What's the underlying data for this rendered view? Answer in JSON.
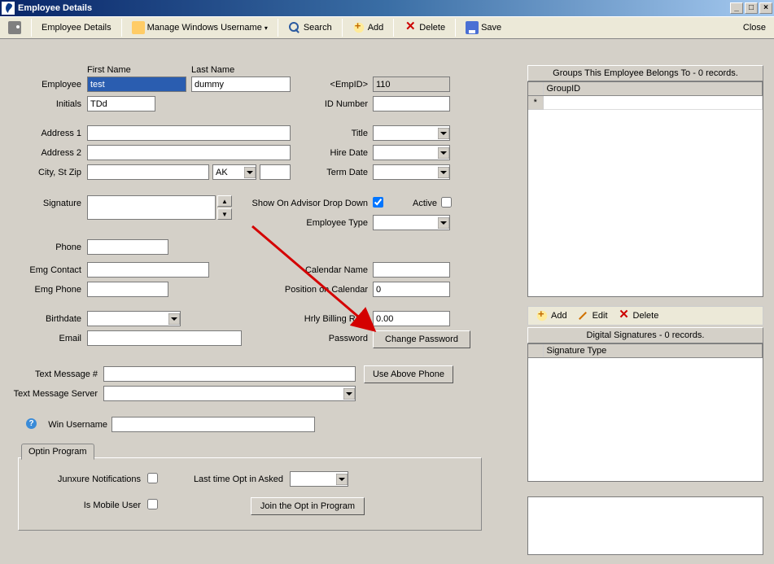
{
  "window": {
    "title": "Employee Details"
  },
  "toolbar": {
    "employee_details": "Employee Details",
    "manage_windows_username": "Manage Windows Username",
    "search": "Search",
    "add": "Add",
    "delete": "Delete",
    "save": "Save",
    "close": "Close"
  },
  "headers": {
    "first_name": "First Name",
    "last_name": "Last Name"
  },
  "labels": {
    "employee": "Employee",
    "initials": "Initials",
    "emp_id": "<EmpID>",
    "id_number": "ID Number",
    "address1": "Address 1",
    "address2": "Address 2",
    "city_st_zip": "City, St Zip",
    "title": "Title",
    "hire_date": "Hire Date",
    "term_date": "Term Date",
    "signature": "Signature",
    "show_on_advisor": "Show On Advisor Drop Down",
    "active": "Active",
    "employee_type": "Employee Type",
    "phone": "Phone",
    "emg_contact": "Emg Contact",
    "emg_phone": "Emg Phone",
    "calendar_name": "Calendar Name",
    "position_on_calendar": "Position on Calendar",
    "birthdate": "Birthdate",
    "email": "Email",
    "hrly_billing_rate": "Hrly Billing Rate",
    "password": "Password",
    "text_message_num": "Text Message #",
    "text_message_server": "Text Message Server",
    "win_username": "Win Username",
    "optin_program": "Optin Program",
    "junxure_notifications": "Junxure Notifications",
    "is_mobile_user": "Is Mobile User",
    "last_time_opt": "Last time Opt in Asked"
  },
  "values": {
    "first_name": "test",
    "last_name": "dummy",
    "initials": "TDd",
    "emp_id": "110",
    "id_number": "",
    "address1": "",
    "address2": "",
    "city": "",
    "state": "AK",
    "zip": "",
    "title": "",
    "hire_date": "",
    "term_date": "",
    "signature": "",
    "show_on_advisor": true,
    "active": false,
    "employee_type": "",
    "phone": "",
    "emg_contact": "",
    "emg_phone": "",
    "calendar_name": "",
    "position_on_calendar": "0",
    "birthdate": "",
    "email": "",
    "hrly_billing_rate": "0.00",
    "text_message_num": "",
    "text_message_server": "",
    "win_username": "",
    "junxure_notifications": false,
    "is_mobile_user": false,
    "last_time_opt": ""
  },
  "buttons": {
    "change_password": "Change Password",
    "use_above_phone": "Use Above Phone",
    "join_optin": "Join the Opt in Program"
  },
  "groups_panel": {
    "header": "Groups This Employee Belongs To - 0 records.",
    "col_groupid": "GroupID",
    "newrow_marker": "*"
  },
  "group_actions": {
    "add": "Add",
    "edit": "Edit",
    "delete": "Delete"
  },
  "signatures_panel": {
    "header": "Digital Signatures - 0 records.",
    "col_sigtype": "Signature Type"
  }
}
